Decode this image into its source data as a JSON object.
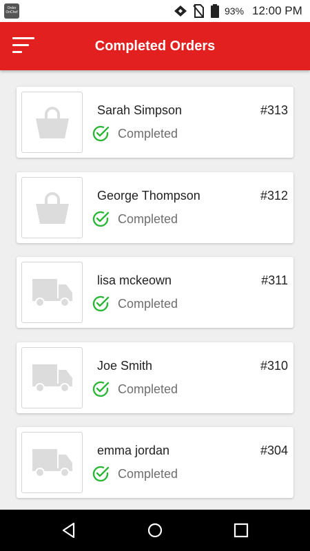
{
  "status_bar": {
    "app_icon_label": "Order OnChef",
    "battery_percent": "93%",
    "time": "12:00 PM"
  },
  "header": {
    "title": "Completed Orders",
    "menu_icon": "menu-icon"
  },
  "orders": [
    {
      "name": "Sarah Simpson",
      "number": "#313",
      "status": "Completed",
      "type_icon": "shopping-basket-icon"
    },
    {
      "name": "George Thompson",
      "number": "#312",
      "status": "Completed",
      "type_icon": "shopping-basket-icon"
    },
    {
      "name": "lisa mckeown",
      "number": "#311",
      "status": "Completed",
      "type_icon": "delivery-truck-icon"
    },
    {
      "name": "Joe Smith",
      "number": "#310",
      "status": "Completed",
      "type_icon": "delivery-truck-icon"
    },
    {
      "name": "emma jordan",
      "number": "#304",
      "status": "Completed",
      "type_icon": "delivery-truck-icon"
    }
  ],
  "colors": {
    "brand": "#e1201f",
    "status_check": "#2bb637",
    "icon_gray": "#dcdcdc"
  },
  "nav_bar": {
    "icons": [
      "back-icon",
      "home-icon",
      "recents-icon"
    ]
  }
}
